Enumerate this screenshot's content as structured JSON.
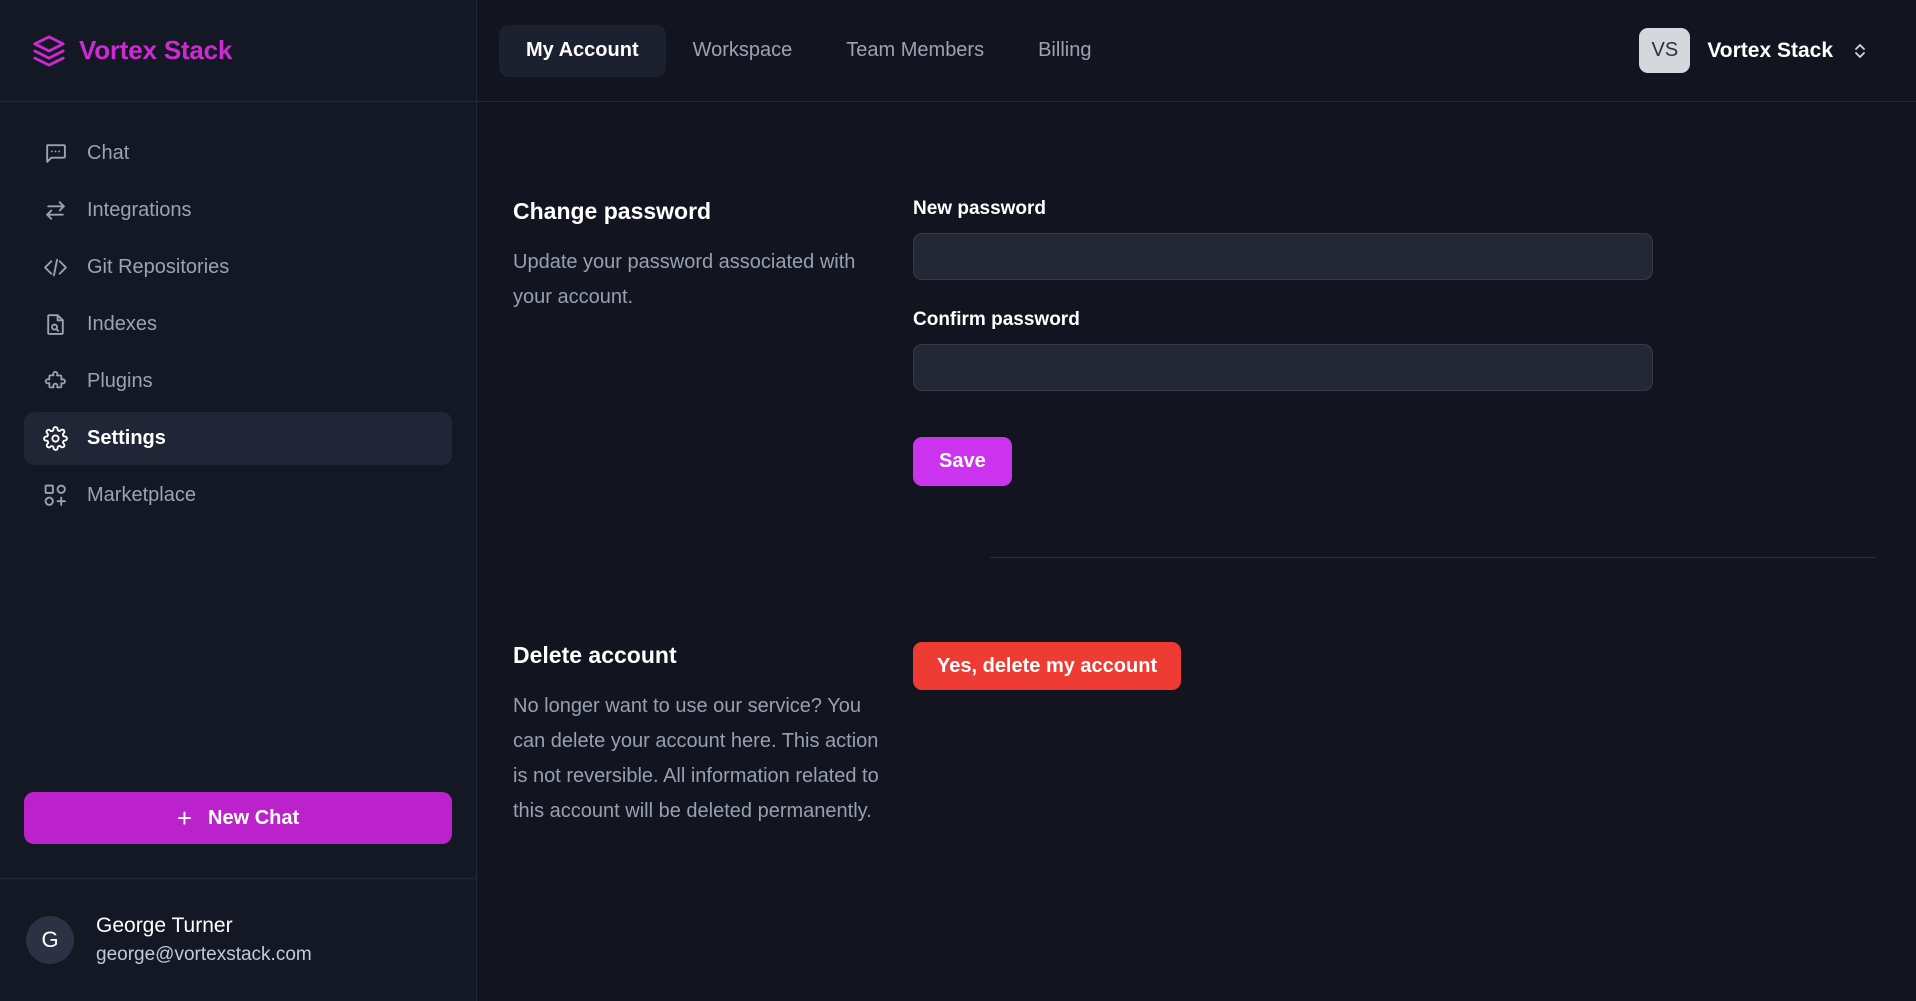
{
  "brand": {
    "name": "Vortex Stack",
    "logo_icon": "layers-stack-icon",
    "color": "#cc2bd4"
  },
  "sidebar": {
    "items": [
      {
        "label": "Chat",
        "icon": "chat-bubble-icon",
        "active": false
      },
      {
        "label": "Integrations",
        "icon": "swap-arrows-icon",
        "active": false
      },
      {
        "label": "Git Repositories",
        "icon": "code-brackets-icon",
        "active": false
      },
      {
        "label": "Indexes",
        "icon": "document-search-icon",
        "active": false
      },
      {
        "label": "Plugins",
        "icon": "puzzle-piece-icon",
        "active": false
      },
      {
        "label": "Settings",
        "icon": "gear-icon",
        "active": true
      },
      {
        "label": "Marketplace",
        "icon": "grid-plus-icon",
        "active": false
      }
    ],
    "new_chat": {
      "label": "New Chat",
      "icon": "plus-icon",
      "color": "#bb22cc"
    },
    "user": {
      "initial": "G",
      "name": "George Turner",
      "email": "george@vortexstack.com"
    }
  },
  "topbar": {
    "tabs": [
      {
        "label": "My Account",
        "active": true
      },
      {
        "label": "Workspace",
        "active": false
      },
      {
        "label": "Team Members",
        "active": false
      },
      {
        "label": "Billing",
        "active": false
      }
    ],
    "account": {
      "badge": "VS",
      "name": "Vortex Stack",
      "chevron_icon": "chevron-up-down-icon"
    }
  },
  "main": {
    "change_password": {
      "title": "Change password",
      "description": "Update your password associated with your account.",
      "new_password": {
        "label": "New password",
        "value": "",
        "placeholder": ""
      },
      "confirm_password": {
        "label": "Confirm password",
        "value": "",
        "placeholder": ""
      },
      "save_label": "Save",
      "save_color": "#cc33ee"
    },
    "delete_account": {
      "title": "Delete account",
      "description": "No longer want to use our service? You can delete your account here. This action is not reversible. All information related to this account will be deleted permanently.",
      "button_label": "Yes, delete my account",
      "button_color": "#ee3b33"
    }
  }
}
